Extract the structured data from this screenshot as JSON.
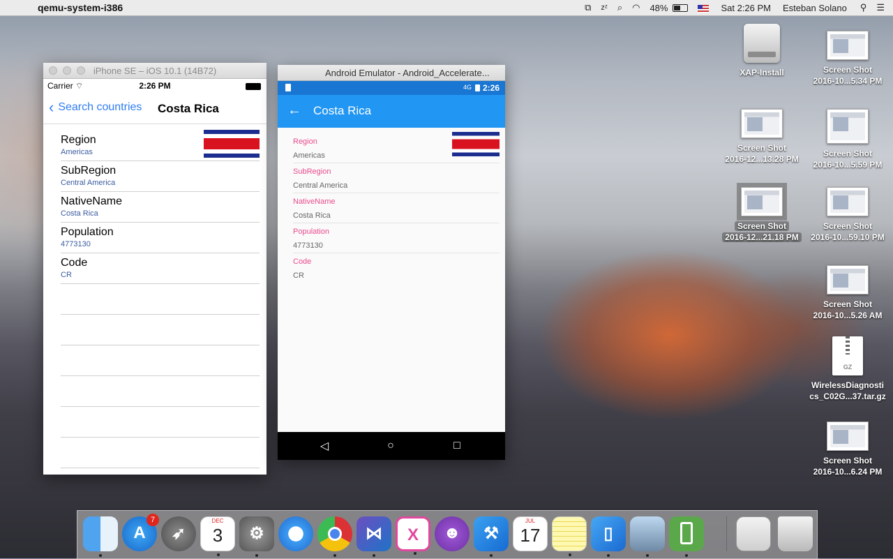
{
  "menubar": {
    "app_name": "qemu-system-i386",
    "battery_percent": "48%",
    "clock": "Sat 2:26 PM",
    "user": "Esteban Solano"
  },
  "ios_window": {
    "title": "iPhone SE – iOS 10.1 (14B72)",
    "status": {
      "carrier": "Carrier",
      "time": "2:26 PM"
    },
    "nav": {
      "back_label": "Search countries",
      "title": "Costa Rica"
    },
    "rows": [
      {
        "label": "Region",
        "value": "Americas"
      },
      {
        "label": "SubRegion",
        "value": "Central America"
      },
      {
        "label": "NativeName",
        "value": "Costa Rica"
      },
      {
        "label": "Population",
        "value": "4773130"
      },
      {
        "label": "Code",
        "value": "CR"
      }
    ]
  },
  "android_window": {
    "title": "Android Emulator - Android_Accelerate...",
    "status": {
      "time": "2:26",
      "network": "4G"
    },
    "toolbar_title": "Costa Rica",
    "rows": [
      {
        "label": "Region",
        "value": "Americas"
      },
      {
        "label": "SubRegion",
        "value": "Central America"
      },
      {
        "label": "NativeName",
        "value": "Costa Rica"
      },
      {
        "label": "Population",
        "value": "4773130"
      },
      {
        "label": "Code",
        "value": "CR"
      }
    ]
  },
  "desktop_icons": [
    {
      "line1": "XAP-Install",
      "line2": ""
    },
    {
      "line1": "Screen Shot",
      "line2": "2016-10...5.34 PM"
    },
    {
      "line1": "Screen Shot",
      "line2": "2016-12...13.28 PM"
    },
    {
      "line1": "Screen Shot",
      "line2": "2016-10...5.59 PM"
    },
    {
      "line1": "Screen Shot",
      "line2": "2016-12...21.18 PM"
    },
    {
      "line1": "Screen Shot",
      "line2": "2016-10...59.10 PM"
    },
    {
      "line1": "Screen Shot",
      "line2": "2016-10...5.26 AM"
    },
    {
      "line1": "WirelessDiagnosti",
      "line2": "cs_C02G...37.tar.gz"
    },
    {
      "line1": "Screen Shot",
      "line2": "2016-10...6.24 PM"
    }
  ],
  "gz_label": "GZ",
  "dock": {
    "app_store_badge": "7",
    "calendar_month_1": "DEC",
    "calendar_day_1": "3",
    "calendar_month_2": "JUL",
    "calendar_day_2": "17"
  },
  "colors": {
    "ios_blue": "#2f7ef1",
    "android_primary": "#2196f3",
    "android_primary_dark": "#1976d2",
    "android_label_pink": "#e94a8c"
  }
}
